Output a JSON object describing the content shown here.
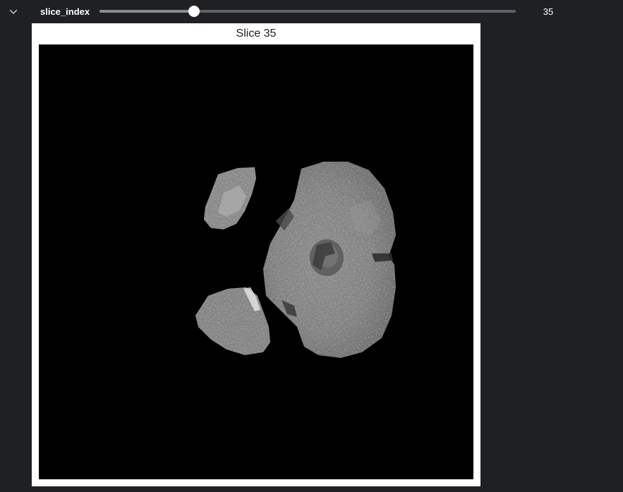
{
  "controls": {
    "slider": {
      "label": "slice_index",
      "value": 35,
      "value_text": "35",
      "min": 0,
      "max": 154
    },
    "toggle_icon": "chevron-down-icon"
  },
  "figure": {
    "title": "Slice 35",
    "colormap": "gray",
    "background": "#000000"
  },
  "colors": {
    "page_background": "#1f2023",
    "track": "#5f6166",
    "handle": "#ffffff",
    "figure_background": "#ffffff"
  }
}
